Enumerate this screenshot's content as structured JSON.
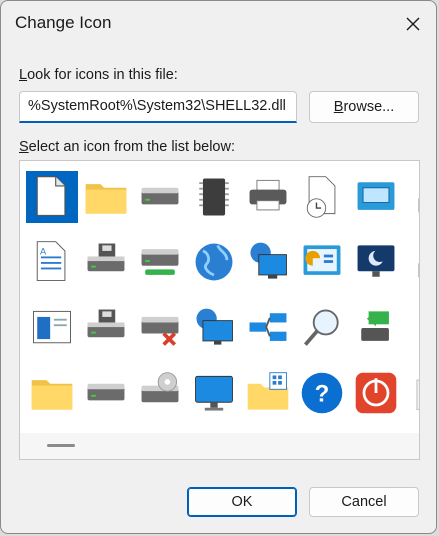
{
  "window": {
    "title": "Change Icon"
  },
  "look_label": {
    "prefix": "",
    "accel": "L",
    "rest": "ook for icons in this file:"
  },
  "path_value": "%SystemRoot%\\System32\\SHELL32.dll",
  "browse": {
    "accel": "B",
    "rest": "rowse..."
  },
  "select_label": {
    "accel": "S",
    "rest": "elect an icon from the list below:"
  },
  "icons": [
    [
      "blank-document-icon",
      "folder-icon",
      "drive-icon",
      "chip-icon",
      "printer-icon",
      "document-clock-icon",
      "window-app-icon",
      "shortcut-arrow-icon"
    ],
    [
      "text-document-icon",
      "floppy-drive-icon",
      "network-drive-icon",
      "globe-icon",
      "network-computer-icon",
      "control-panel-icon",
      "monitor-moon-icon",
      "shortcut-arrow-icon"
    ],
    [
      "window-document-icon",
      "floppy-drive-icon",
      "disconnected-drive-icon",
      "globe-computer-icon",
      "network-connections-icon",
      "search-icon",
      "usb-drive-icon",
      "box-icon"
    ],
    [
      "folder-icon",
      "drive-icon",
      "cd-drive-icon",
      "monitor-icon",
      "folder-grid-icon",
      "help-icon",
      "power-icon",
      "recycle-bin-icon"
    ]
  ],
  "buttons": {
    "ok": "OK",
    "cancel": "Cancel"
  }
}
